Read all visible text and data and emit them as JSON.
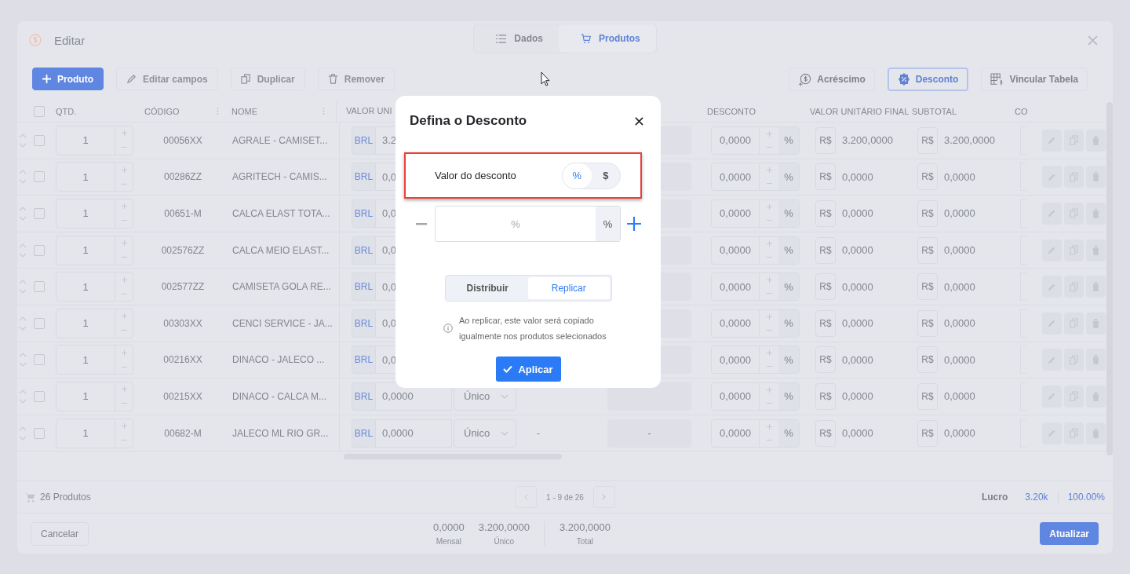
{
  "header": {
    "title": "Editar",
    "tabs": [
      {
        "label": "Dados",
        "selected": false
      },
      {
        "label": "Produtos",
        "selected": true
      }
    ]
  },
  "toolbar": {
    "left": [
      {
        "label": "Produto",
        "disabled": false
      },
      {
        "label": "Editar campos",
        "disabled": true
      },
      {
        "label": "Duplicar",
        "disabled": true
      },
      {
        "label": "Remover",
        "disabled": true
      }
    ],
    "right": [
      {
        "label": "Acréscimo",
        "selected": false
      },
      {
        "label": "Desconto",
        "selected": true
      },
      {
        "label": "Vincular Tabela",
        "selected": false
      }
    ]
  },
  "table": {
    "select_all": {
      "checked": false
    },
    "columns": [
      "QTD.",
      "CÓDIGO",
      "NOME",
      "VALOR UNI",
      "DESCONTO",
      "VALOR UNITÁRIO FINAL",
      "SUBTOTAL",
      "CO"
    ],
    "rows": [
      {
        "checked": false,
        "qty": "1",
        "code": "00056XX",
        "name": "AGRALE - CAMISET...",
        "currency": "BRL",
        "unit_value": "3.2",
        "discount": "0,0000",
        "discount_unit": "%",
        "final_currency": "R$",
        "final_value": "3.200,0000",
        "subtotal_currency": "R$",
        "subtotal": "3.200,0000"
      },
      {
        "checked": false,
        "qty": "1",
        "code": "00286ZZ",
        "name": "AGRITECH - CAMIS...",
        "currency": "BRL",
        "unit_value": "0,0",
        "discount": "0,0000",
        "discount_unit": "%",
        "final_currency": "R$",
        "final_value": "0,0000",
        "subtotal_currency": "R$",
        "subtotal": "0,0000"
      },
      {
        "checked": false,
        "qty": "1",
        "code": "00651-M",
        "name": "CALCA ELAST TOTA...",
        "currency": "BRL",
        "unit_value": "0,0",
        "discount": "0,0000",
        "discount_unit": "%",
        "final_currency": "R$",
        "final_value": "0,0000",
        "subtotal_currency": "R$",
        "subtotal": "0,0000"
      },
      {
        "checked": false,
        "qty": "1",
        "code": "002576ZZ",
        "name": "CALCA MEIO ELAST...",
        "currency": "BRL",
        "unit_value": "0,0",
        "discount": "0,0000",
        "discount_unit": "%",
        "final_currency": "R$",
        "final_value": "0,0000",
        "subtotal_currency": "R$",
        "subtotal": "0,0000"
      },
      {
        "checked": false,
        "qty": "1",
        "code": "002577ZZ",
        "name": "CAMISETA GOLA RE...",
        "currency": "BRL",
        "unit_value": "0,0",
        "discount": "0,0000",
        "discount_unit": "%",
        "final_currency": "R$",
        "final_value": "0,0000",
        "subtotal_currency": "R$",
        "subtotal": "0,0000"
      },
      {
        "checked": false,
        "qty": "1",
        "code": "00303XX",
        "name": "CENCI SERVICE - JA...",
        "currency": "BRL",
        "unit_value": "0,0",
        "discount": "0,0000",
        "discount_unit": "%",
        "final_currency": "R$",
        "final_value": "0,0000",
        "subtotal_currency": "R$",
        "subtotal": "0,0000"
      },
      {
        "checked": false,
        "qty": "1",
        "code": "00216XX",
        "name": "DINACO - JALECO ...",
        "currency": "BRL",
        "unit_value": "0,0",
        "discount": "0,0000",
        "discount_unit": "%",
        "final_currency": "R$",
        "final_value": "0,0000",
        "subtotal_currency": "R$",
        "subtotal": "0,0000"
      },
      {
        "checked": false,
        "qty": "1",
        "code": "00215XX",
        "name": "DINACO - CALCA M...",
        "currency": "BRL",
        "unit_value": "0,0000",
        "billing": "Único",
        "discount": "0,0000",
        "discount_unit": "%",
        "final_currency": "R$",
        "final_value": "0,0000",
        "subtotal_currency": "R$",
        "subtotal": "0,0000"
      },
      {
        "checked": false,
        "qty": "1",
        "code": "00682-M",
        "name": "JALECO ML RIO GR...",
        "currency": "BRL",
        "unit_value": "0,0000",
        "billing": "Único",
        "column_9": "-",
        "column_10": "-",
        "discount": "0,0000",
        "discount_unit": "%",
        "final_currency": "R$",
        "final_value": "0,0000",
        "subtotal_currency": "R$",
        "subtotal": "0,0000"
      }
    ]
  },
  "footer": {
    "count": "26 Produtos",
    "pagination": "1 - 9 de 26",
    "profit_label": "Lucro",
    "profit_value": "3.20k",
    "profit_percent": "100.00%"
  },
  "bottom_bar": {
    "cancel": "Cancelar",
    "totals": [
      {
        "value": "0,0000",
        "label": "Mensal"
      },
      {
        "value": "3.200,0000",
        "label": "Único"
      },
      {
        "value": "3.200,0000",
        "label": "Total"
      }
    ],
    "update": "Atualizar"
  },
  "dialog": {
    "title": "Defina o Desconto",
    "field_label": "Valor do desconto",
    "unit_toggle": [
      {
        "label": "%",
        "selected": true
      },
      {
        "label": "$",
        "selected": false
      }
    ],
    "input": {
      "placeholder": "%",
      "suffix": "%"
    },
    "mode": [
      {
        "label": "Distribuir",
        "selected": false
      },
      {
        "label": "Replicar",
        "selected": true
      }
    ],
    "info": "Ao replicar, este valor será copiado igualmente nos produtos selecionados",
    "apply": "Aplicar"
  }
}
